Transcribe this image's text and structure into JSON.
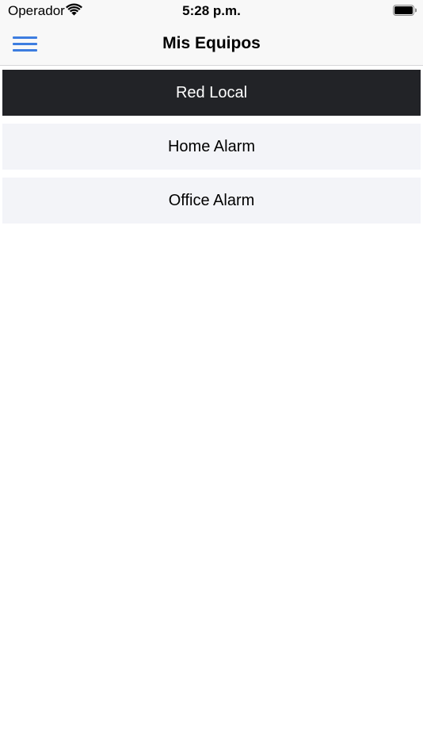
{
  "status_bar": {
    "carrier": "Operador",
    "time": "5:28 p.m.",
    "wifi_icon": "wifi-icon",
    "battery_icon": "battery-full-icon"
  },
  "nav": {
    "title": "Mis Equipos",
    "menu_icon": "hamburger-menu-icon",
    "accent_color": "#3d7de0"
  },
  "devices": [
    {
      "label": "Red Local",
      "selected": true
    },
    {
      "label": "Home Alarm",
      "selected": false
    },
    {
      "label": "Office Alarm",
      "selected": false
    }
  ],
  "colors": {
    "selected_bg": "#222327",
    "item_bg": "#f3f4f8",
    "bar_bg": "#f8f8f8"
  }
}
